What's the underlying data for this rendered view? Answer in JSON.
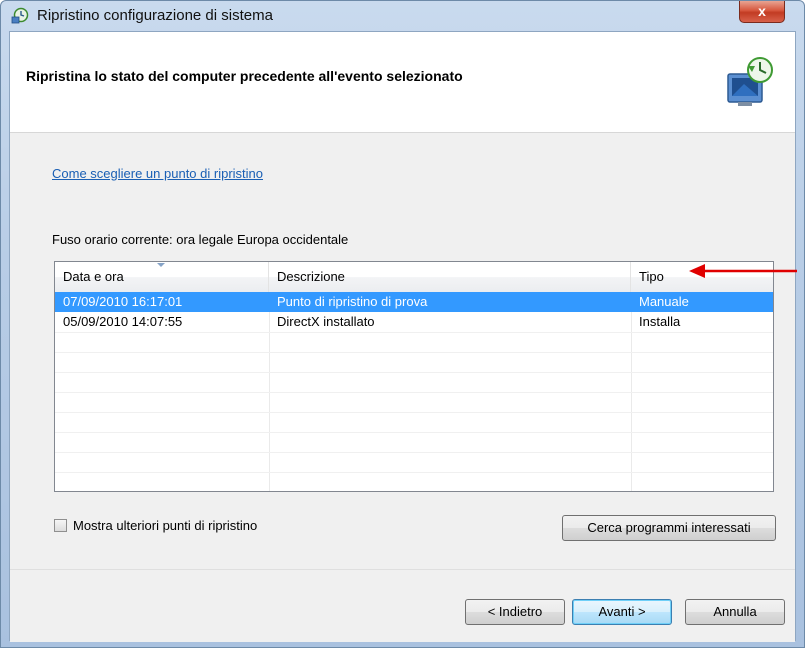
{
  "window": {
    "title": "Ripristino configurazione di sistema",
    "close_glyph": "x"
  },
  "header": {
    "title": "Ripristina lo stato del computer precedente all'evento selezionato",
    "icon": "system-restore-icon"
  },
  "content": {
    "help_link": "Come scegliere un punto di ripristino",
    "timezone_label": "Fuso orario corrente: ora legale Europa occidentale"
  },
  "table": {
    "columns": [
      "Data e ora",
      "Descrizione",
      "Tipo"
    ],
    "rows": [
      {
        "date": "07/09/2010 16:17:01",
        "description": "Punto di ripristino di prova",
        "type": "Manuale",
        "selected": true
      },
      {
        "date": "05/09/2010 14:07:55",
        "description": "DirectX installato",
        "type": "Installa",
        "selected": false
      }
    ]
  },
  "options": {
    "show_more_label": "Mostra ulteriori punti di ripristino",
    "show_more_checked": false
  },
  "buttons": {
    "scan": "Cerca programmi interessati",
    "back": "< Indietro",
    "next": "Avanti >",
    "cancel": "Annulla"
  },
  "colors": {
    "selection": "#3399ff",
    "link": "#1a5fb4",
    "annotation_arrow": "#e00000"
  }
}
